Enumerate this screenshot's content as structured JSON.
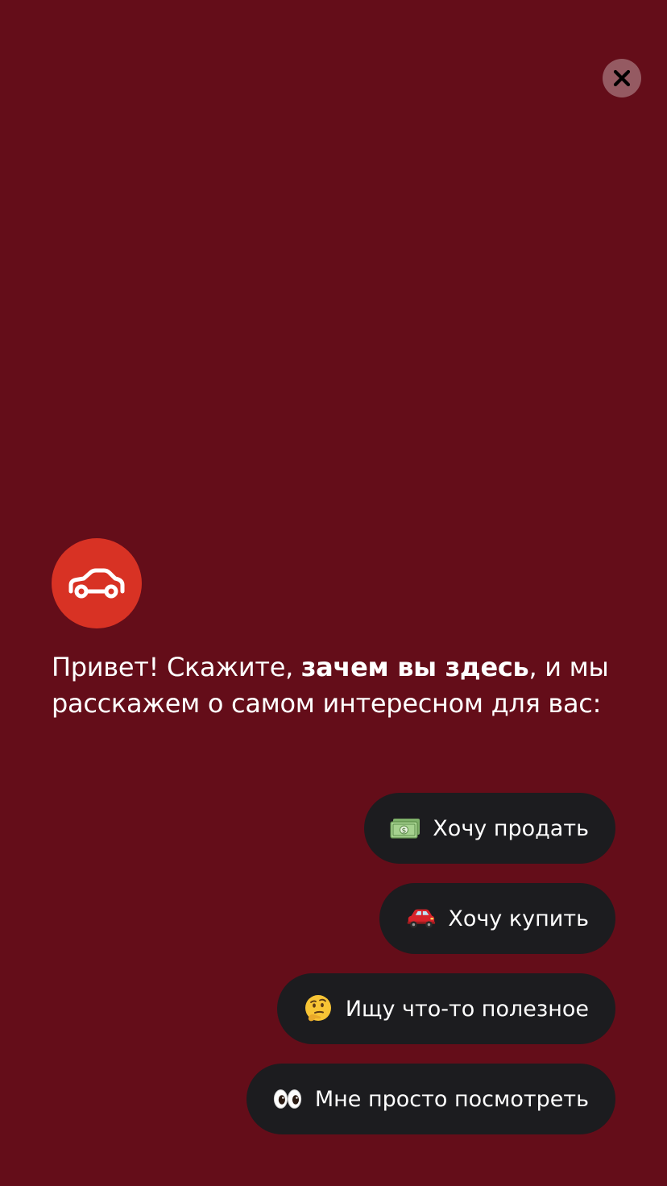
{
  "close_button": {
    "icon": "close-icon"
  },
  "logo": {
    "icon": "car-icon",
    "background": "#d83224"
  },
  "greeting": {
    "prefix": "Привет! Скажите, ",
    "emphasis": "зачем вы здесь",
    "suffix": ", и мы расскажем о самом интересном для вас:"
  },
  "options": [
    {
      "emoji": "money-emoji",
      "label": "Хочу продать"
    },
    {
      "emoji": "red-car-emoji",
      "label": "Хочу купить"
    },
    {
      "emoji": "thinking-face-emoji",
      "label": "Ищу что-то полезное"
    },
    {
      "emoji": "eyes-emoji",
      "label": "Мне просто посмотреть"
    }
  ],
  "colors": {
    "background": "#640d19",
    "accent": "#d83224",
    "option_background": "#1c1c1f",
    "text": "#ffffff"
  }
}
